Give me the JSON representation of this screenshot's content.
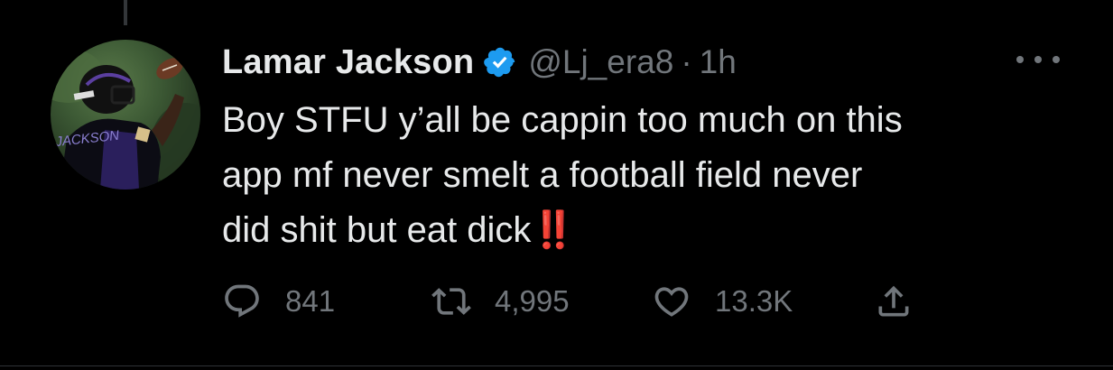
{
  "tweet": {
    "author": {
      "display_name": "Lamar Jackson",
      "handle": "@Lj_era8",
      "verified": true,
      "avatar_jersey_text": "JACKSON"
    },
    "separator": "·",
    "time": "1h",
    "text_main": "Boy STFU y’all be cappin too much on this\napp mf never smelt a football field never\ndid shit but eat dick",
    "text_emoji": "‼️",
    "actions": {
      "reply_count": "841",
      "retweet_count": "4,995",
      "like_count": "13.3K"
    },
    "icons": {
      "verified": "verified-badge-icon",
      "more": "more-horizontal-icon",
      "reply": "reply-icon",
      "retweet": "retweet-icon",
      "like": "heart-icon",
      "share": "share-icon"
    },
    "colors": {
      "background": "#000000",
      "text": "#e7e9ea",
      "secondary": "#71767b",
      "verified": "#1d9bf0",
      "emoji_red": "#e0302b"
    }
  }
}
